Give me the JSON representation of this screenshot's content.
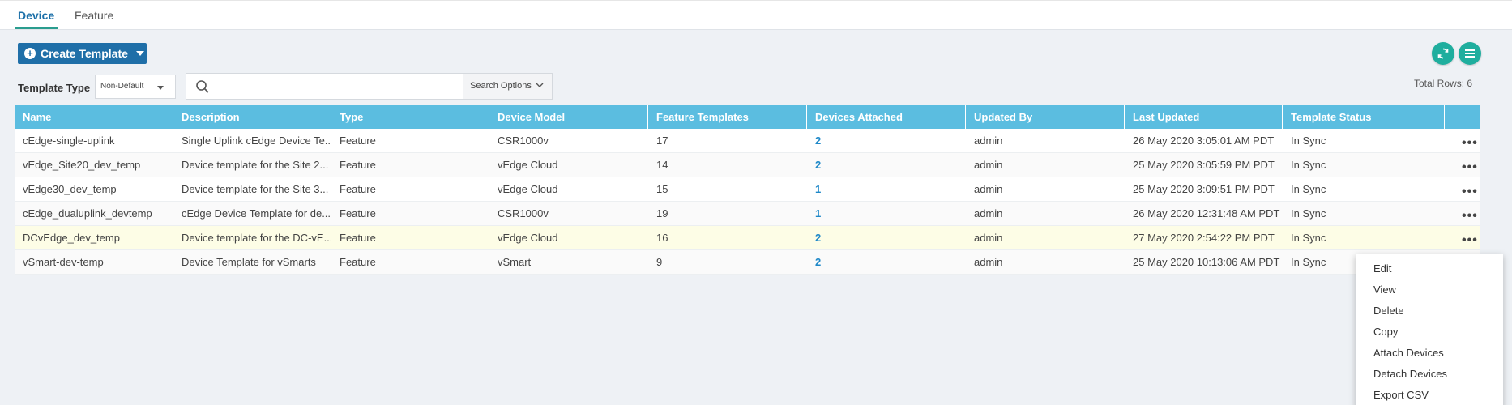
{
  "tabs": [
    {
      "label": "Device",
      "active": true
    },
    {
      "label": "Feature",
      "active": false
    }
  ],
  "toolbar": {
    "create_label": "Create Template",
    "template_type_label": "Template Type",
    "template_type_value": "Non-Default",
    "search_placeholder": "",
    "search_options_label": "Search Options",
    "total_rows": "Total Rows: 6"
  },
  "colors": {
    "accent": "#1f6fa8",
    "header": "#5bbde0",
    "teal": "#1fae9e",
    "link": "#1e88c8"
  },
  "table": {
    "columns": [
      "Name",
      "Description",
      "Type",
      "Device Model",
      "Feature Templates",
      "Devices Attached",
      "Updated By",
      "Last Updated",
      "Template Status"
    ],
    "rows": [
      {
        "name": "cEdge-single-uplink",
        "description": "Single Uplink cEdge Device Te...",
        "type": "Feature",
        "model": "CSR1000v",
        "feature_templates": "17",
        "devices": "2",
        "updated_by": "admin",
        "last_updated": "26 May 2020 3:05:01 AM PDT",
        "status": "In Sync"
      },
      {
        "name": "vEdge_Site20_dev_temp",
        "description": "Device template for the Site 2...",
        "type": "Feature",
        "model": "vEdge Cloud",
        "feature_templates": "14",
        "devices": "2",
        "updated_by": "admin",
        "last_updated": "25 May 2020 3:05:59 PM PDT",
        "status": "In Sync"
      },
      {
        "name": "vEdge30_dev_temp",
        "description": "Device template for the Site 3...",
        "type": "Feature",
        "model": "vEdge Cloud",
        "feature_templates": "15",
        "devices": "1",
        "updated_by": "admin",
        "last_updated": "25 May 2020 3:09:51 PM PDT",
        "status": "In Sync"
      },
      {
        "name": "cEdge_dualuplink_devtemp",
        "description": "cEdge Device Template for de...",
        "type": "Feature",
        "model": "CSR1000v",
        "feature_templates": "19",
        "devices": "1",
        "updated_by": "admin",
        "last_updated": "26 May 2020 12:31:48 AM PDT",
        "status": "In Sync"
      },
      {
        "name": "DCvEdge_dev_temp",
        "description": "Device template for the DC-vE...",
        "type": "Feature",
        "model": "vEdge Cloud",
        "feature_templates": "16",
        "devices": "2",
        "updated_by": "admin",
        "last_updated": "27 May 2020 2:54:22 PM PDT",
        "status": "In Sync"
      },
      {
        "name": "vSmart-dev-temp",
        "description": "Device Template for vSmarts",
        "type": "Feature",
        "model": "vSmart",
        "feature_templates": "9",
        "devices": "2",
        "updated_by": "admin",
        "last_updated": "25 May 2020 10:13:06 AM PDT",
        "status": "In Sync"
      }
    ]
  },
  "context_menu": {
    "items": [
      "Edit",
      "View",
      "Delete",
      "Copy",
      "Attach Devices",
      "Detach Devices",
      "Export CSV"
    ]
  }
}
